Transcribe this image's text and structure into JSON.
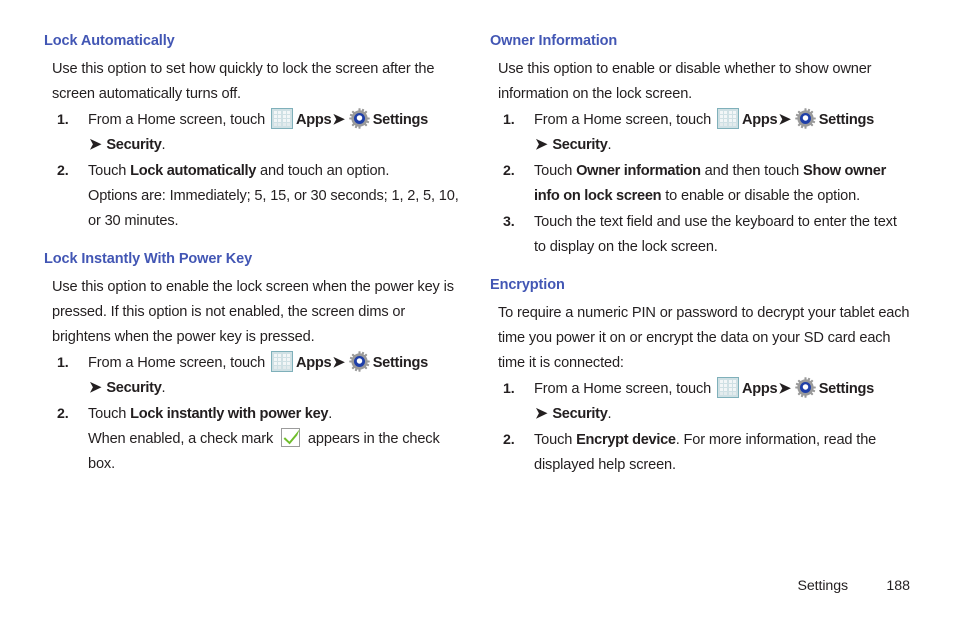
{
  "page": {
    "footer_label": "Settings",
    "footer_page_number": "188",
    "heading_color": "#4256b4",
    "text_color": "#231f20",
    "background_color": "#ffffff"
  },
  "icons": {
    "apps": "apps-grid-icon",
    "settings": "settings-gear-icon",
    "checkbox": "green-checkmark-icon",
    "arrow": "➔"
  },
  "left_column": {
    "sections": [
      {
        "heading": "Lock Automatically",
        "intro": "Use this option to set how quickly to lock the screen after the screen automatically turns off.",
        "steps": [
          {
            "number": "1.",
            "text_before_apps": "From a Home screen, touch ",
            "apps_label": "Apps",
            "settings_label": "Settings",
            "continuation_label": "Security",
            "continuation_suffix": "."
          },
          {
            "number": "2.",
            "text_prefix": "Touch ",
            "bold_1": "Lock automatically",
            "text_suffix": " and touch an option.",
            "sub_line": "Options are: Immediately; 5, 15, or 30 seconds; 1, 2, 5, 10, or 30 minutes."
          }
        ]
      },
      {
        "heading": "Lock Instantly With Power Key",
        "intro": "Use this option to enable the lock screen when the power key is pressed. If this option is not enabled, the screen dims or brightens when the power key is pressed.",
        "steps": [
          {
            "number": "1.",
            "text_before_apps": "From a Home screen, touch ",
            "apps_label": "Apps",
            "settings_label": "Settings",
            "continuation_label": "Security",
            "continuation_suffix": "."
          },
          {
            "number": "2.",
            "text_prefix": "Touch ",
            "bold_1": "Lock instantly with power key",
            "text_suffix": ".",
            "sub_before_check": "When enabled, a check mark ",
            "sub_after_check": " appears in the check box."
          }
        ]
      }
    ]
  },
  "right_column": {
    "sections": [
      {
        "heading": "Owner Information",
        "intro": "Use this option to enable or disable whether to show owner information on the lock screen.",
        "steps": [
          {
            "number": "1.",
            "text_before_apps": "From a Home screen, touch ",
            "apps_label": "Apps",
            "settings_label": "Settings",
            "continuation_label": "Security",
            "continuation_suffix": "."
          },
          {
            "number": "2.",
            "text_prefix": "Touch ",
            "bold_1": "Owner information",
            "text_middle": " and then touch ",
            "bold_2": "Show owner info on lock screen",
            "text_suffix": " to enable or disable the option."
          },
          {
            "number": "3.",
            "plain": "Touch the text field and use the keyboard to enter the text to display on the lock screen."
          }
        ]
      },
      {
        "heading": "Encryption",
        "intro": "To require a numeric PIN or password to decrypt your tablet each time you power it on or encrypt the data on your SD card each time it is connected:",
        "steps": [
          {
            "number": "1.",
            "text_before_apps": "From a Home screen, touch ",
            "apps_label": "Apps",
            "settings_label": "Settings",
            "continuation_label": "Security",
            "continuation_suffix": "."
          },
          {
            "number": "2.",
            "text_prefix": "Touch ",
            "bold_1": "Encrypt device",
            "text_suffix": ". For more information, read the displayed help screen."
          }
        ]
      }
    ]
  }
}
